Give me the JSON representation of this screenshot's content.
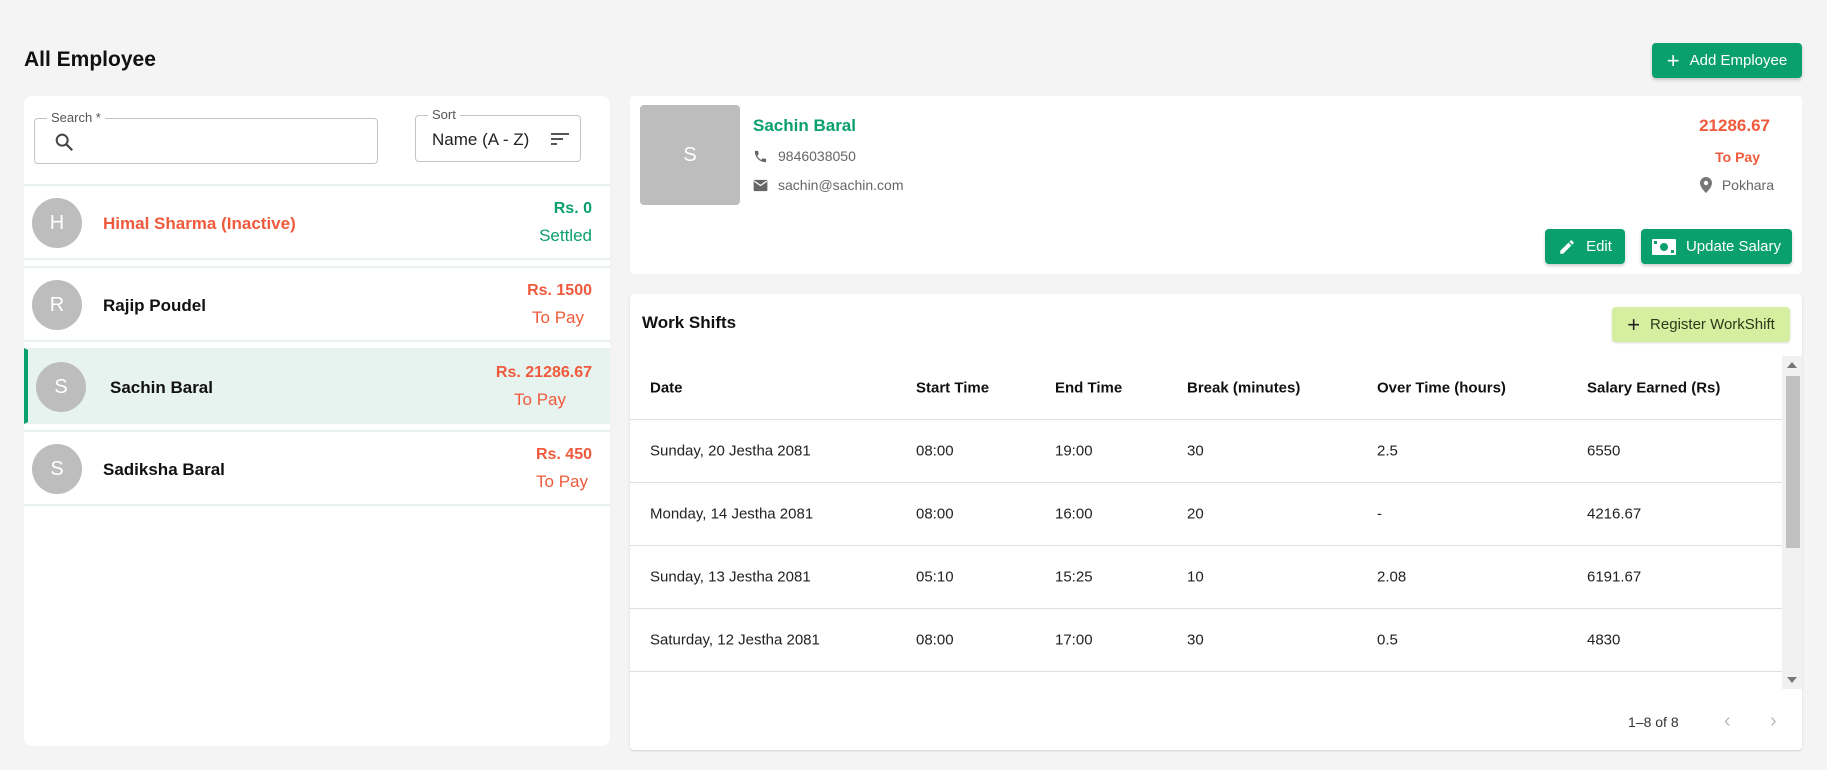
{
  "page": {
    "title": "All Employee",
    "add_button_label": "Add Employee"
  },
  "search": {
    "label": "Search *",
    "value": "",
    "placeholder": ""
  },
  "sort": {
    "label": "Sort",
    "value": "Name (A - Z)"
  },
  "employees": [
    {
      "initial": "H",
      "name": "Himal Sharma (Inactive)",
      "amount": "Rs. 0",
      "status": "Settled",
      "inactive": true,
      "selected": false
    },
    {
      "initial": "R",
      "name": "Rajip Poudel",
      "amount": "Rs. 1500",
      "status": "To Pay",
      "inactive": false,
      "selected": false
    },
    {
      "initial": "S",
      "name": "Sachin Baral",
      "amount": "Rs. 21286.67",
      "status": "To Pay",
      "inactive": false,
      "selected": true
    },
    {
      "initial": "S",
      "name": "Sadiksha Baral",
      "amount": "Rs. 450",
      "status": "To Pay",
      "inactive": false,
      "selected": false
    }
  ],
  "detail": {
    "initial": "S",
    "name": "Sachin Baral",
    "phone": "9846038050",
    "email": "sachin@sachin.com",
    "amount": "21286.67",
    "status": "To Pay",
    "location": "Pokhara",
    "edit_label": "Edit",
    "update_salary_label": "Update Salary"
  },
  "shifts": {
    "title": "Work Shifts",
    "register_label": "Register WorkShift",
    "columns": [
      "Date",
      "Start Time",
      "End Time",
      "Break (minutes)",
      "Over Time (hours)",
      "Salary Earned (Rs)"
    ],
    "rows": [
      [
        "Sunday, 20 Jestha 2081",
        "08:00",
        "19:00",
        "30",
        "2.5",
        "6550"
      ],
      [
        "Monday, 14 Jestha 2081",
        "08:00",
        "16:00",
        "20",
        "-",
        "4216.67"
      ],
      [
        "Sunday, 13 Jestha 2081",
        "05:10",
        "15:25",
        "10",
        "2.08",
        "6191.67"
      ],
      [
        "Saturday, 12 Jestha 2081",
        "08:00",
        "17:00",
        "30",
        "0.5",
        "4830"
      ]
    ],
    "pagination": "1–8 of 8"
  },
  "colors": {
    "accent": "#0aa06e",
    "danger": "#f05a3c",
    "register_bg": "#d6eea0"
  }
}
